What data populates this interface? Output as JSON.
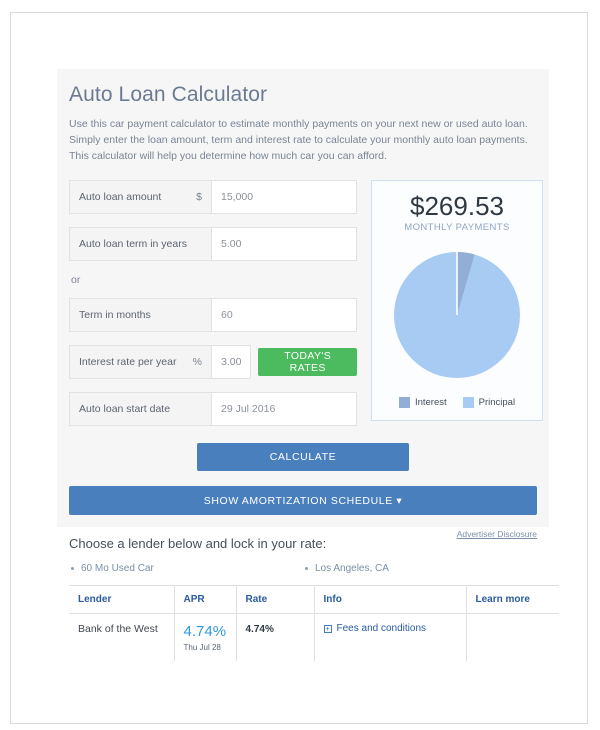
{
  "calculator": {
    "title": "Auto Loan Calculator",
    "description": "Use this car payment calculator to estimate monthly payments on your next new or used auto loan. Simply enter the loan amount, term and interest rate to calculate your monthly auto loan payments. This calculator will help you determine how much car you can afford.",
    "or_label": "or",
    "fields": [
      {
        "label": "Auto loan amount",
        "unit": "$",
        "value": "15,000"
      },
      {
        "label": "Auto loan term in years",
        "unit": "",
        "value": "5.00"
      },
      {
        "label": "Term in months",
        "unit": "",
        "value": "60"
      },
      {
        "label": "Interest rate per year",
        "unit": "%",
        "value": "3.00"
      },
      {
        "label": "Auto loan start date",
        "unit": "",
        "value": "29 Jul 2016"
      }
    ],
    "todays_rates_label": "TODAY'S RATES",
    "calculate_label": "CALCULATE",
    "amortization_label": "SHOW AMORTIZATION SCHEDULE ▾"
  },
  "result": {
    "amount": "$269.53",
    "caption": "MONTHLY PAYMENTS"
  },
  "chart_data": {
    "type": "pie",
    "title": "",
    "labels": [
      "Interest",
      "Principal"
    ],
    "values": [
      4.5,
      95.5
    ],
    "colors": [
      "#92aed6",
      "#a7cbf2"
    ],
    "start_angle_deg": 0,
    "legend_position": "bottom"
  },
  "lenders": {
    "heading": "Choose a lender below and lock in your rate:",
    "disclosure": "Advertiser Disclosure",
    "criteria": [
      "60 Mo Used Car",
      "Los Angeles, CA"
    ],
    "columns": [
      "Lender",
      "APR",
      "Rate",
      "Info",
      "Learn more"
    ],
    "rows": [
      {
        "lender": "Bank of the West",
        "apr": "4.74%",
        "apr_date": "Thu Jul 28",
        "rate": "4.74%",
        "info": "Fees and conditions",
        "info_icon": "expand-plus-icon",
        "learn_more": ""
      }
    ]
  }
}
